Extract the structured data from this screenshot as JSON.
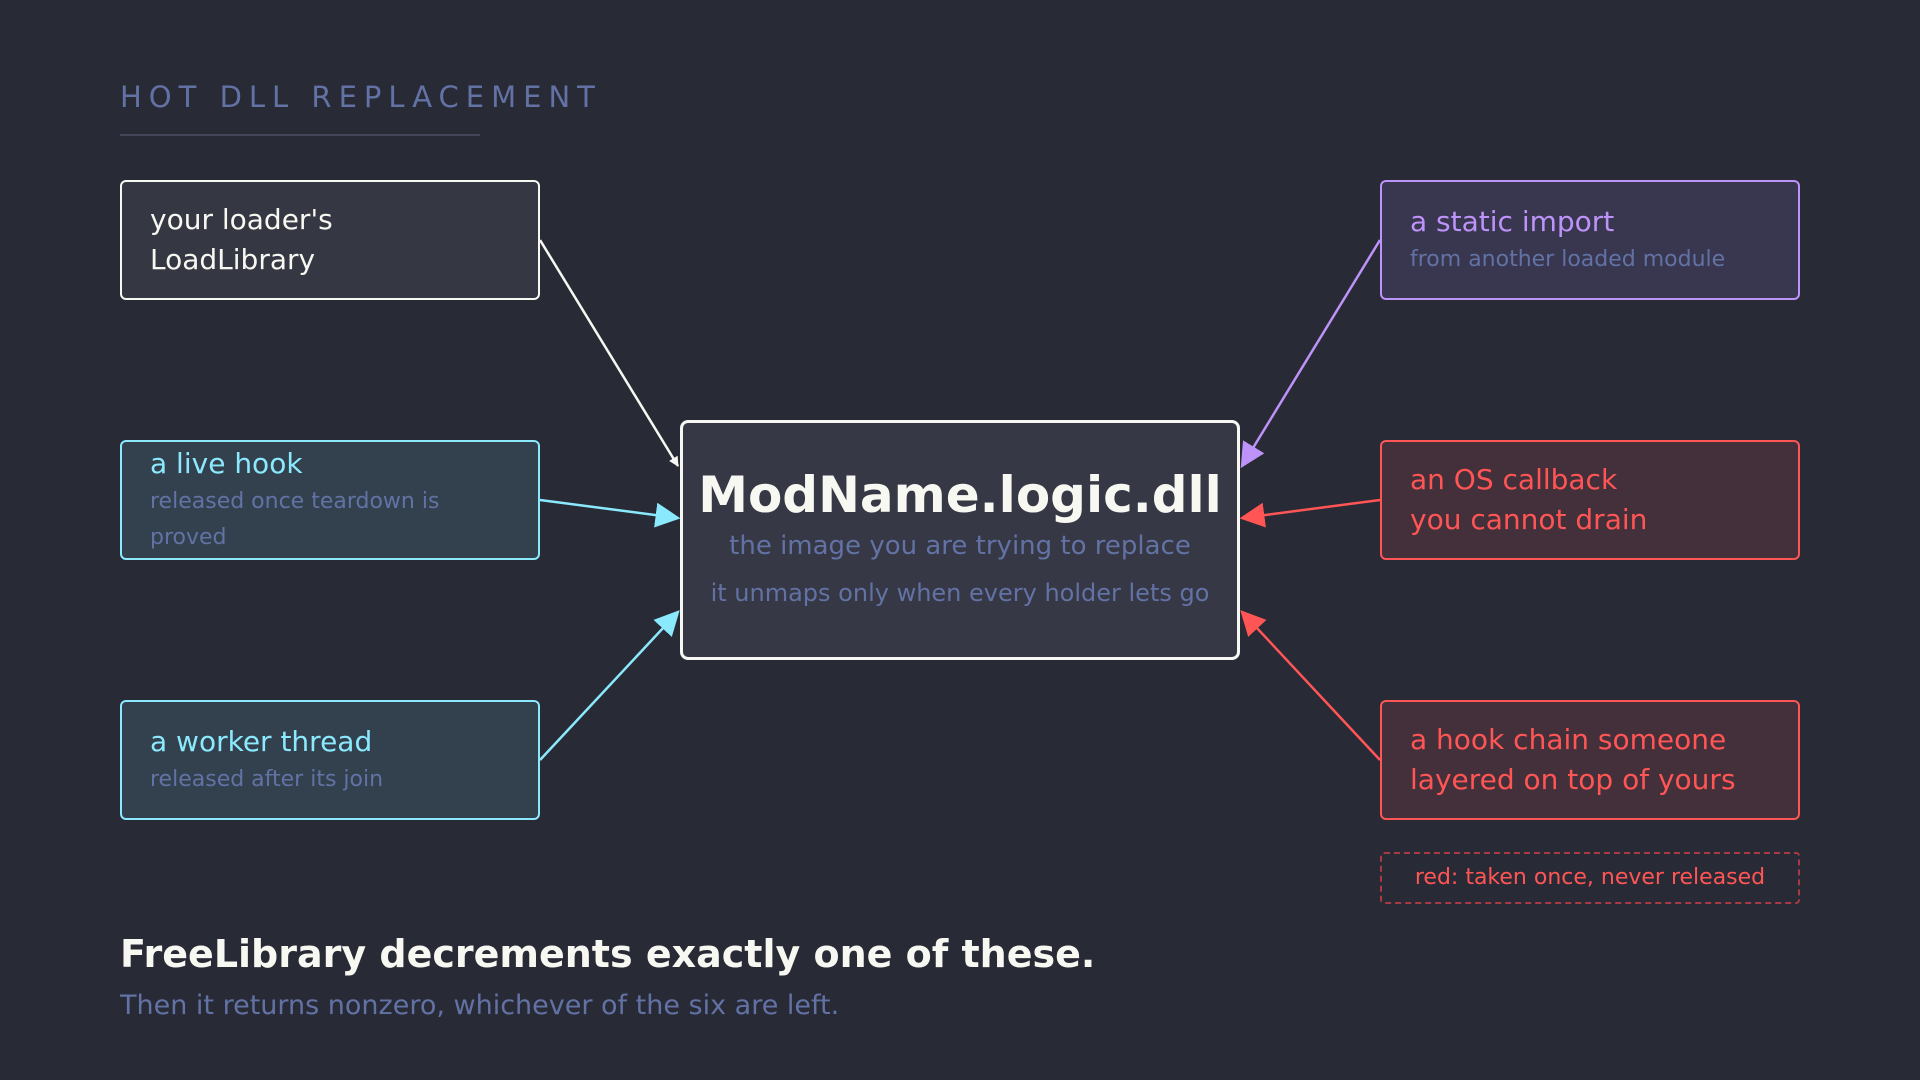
{
  "header": {
    "eyebrow": "HOT DLL REPLACEMENT"
  },
  "center": {
    "name": "ModName.logic.dll",
    "subtitle": "the image you are trying to replace",
    "note": "it unmaps only when every holder lets go"
  },
  "holders": [
    {
      "id": "loader",
      "title": "your loader's\nLoadLibrary",
      "subtitle": "",
      "color": "#f8f8f2"
    },
    {
      "id": "live-hook",
      "title": "a live hook",
      "subtitle": "released once teardown is proved",
      "color": "#8be9fd"
    },
    {
      "id": "worker-thread",
      "title": "a worker thread",
      "subtitle": "released after its join",
      "color": "#8be9fd"
    },
    {
      "id": "static-import",
      "title": "a static import",
      "subtitle": "from another loaded module",
      "color": "#bd93f9"
    },
    {
      "id": "os-callback",
      "title": "an OS callback\nyou cannot drain",
      "subtitle": "",
      "color": "#ff5555"
    },
    {
      "id": "hook-chain",
      "title": "a hook chain someone\nlayered on top of yours",
      "subtitle": "",
      "color": "#ff5555"
    }
  ],
  "legend": {
    "text": "red: taken once, never released"
  },
  "footer": {
    "title": "FreeLibrary decrements exactly one of these.",
    "subtitle": "Then it returns nonzero, whichever of the six are left."
  }
}
